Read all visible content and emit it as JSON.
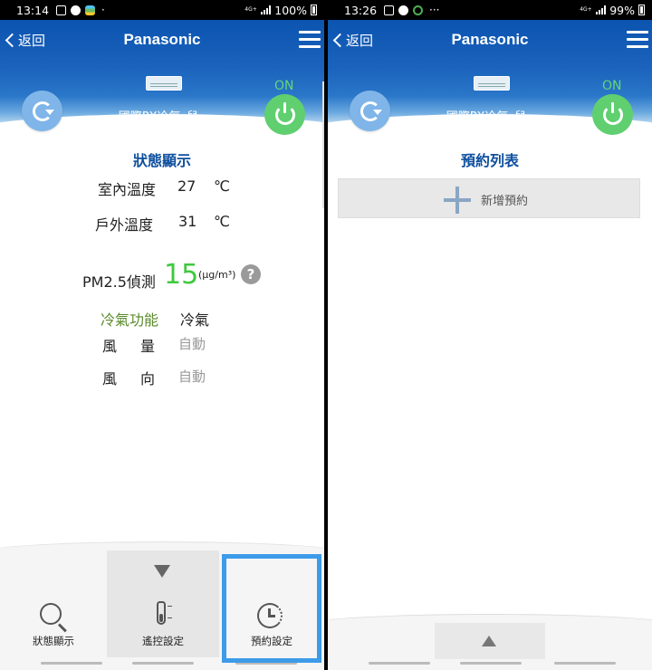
{
  "left": {
    "status_bar": {
      "time": "13:14",
      "network": "4G+",
      "battery": "100%"
    },
    "header": {
      "back_label": "返回",
      "brand": "Panasonic",
      "device_name": "國際PX冷氣_兒..",
      "power_state": "ON"
    },
    "status": {
      "title": "狀態顯示",
      "indoor_label": "室內溫度",
      "indoor_value": "27",
      "indoor_unit": "℃",
      "outdoor_label": "戶外溫度",
      "outdoor_value": "31",
      "outdoor_unit": "℃",
      "pm_label": "PM2.5偵測",
      "pm_value": "15",
      "pm_unit": "(μg/m³)",
      "help": "?",
      "mode_label": "冷氣功能",
      "mode_value": "冷氣",
      "fan_label_a": "風",
      "fan_label_b": "量",
      "fan_value": "自動",
      "dir_label_a": "風",
      "dir_label_b": "向",
      "dir_value": "自動"
    },
    "tabs": {
      "status": "狀態顯示",
      "remote": "遙控設定",
      "schedule": "預約設定"
    }
  },
  "right": {
    "status_bar": {
      "time": "13:26",
      "network": "4G+",
      "battery": "99%"
    },
    "header": {
      "back_label": "返回",
      "brand": "Panasonic",
      "device_name": "國際PX冷氣_兒..",
      "power_state": "ON"
    },
    "schedule": {
      "title": "預約列表",
      "add_label": "新增預約"
    }
  },
  "colors": {
    "header_blue": "#0b54b0",
    "title_blue": "#0e4f9e",
    "on_green": "#5fcf6f",
    "pm_green": "#3ec93e",
    "highlight": "#3d9be9"
  }
}
